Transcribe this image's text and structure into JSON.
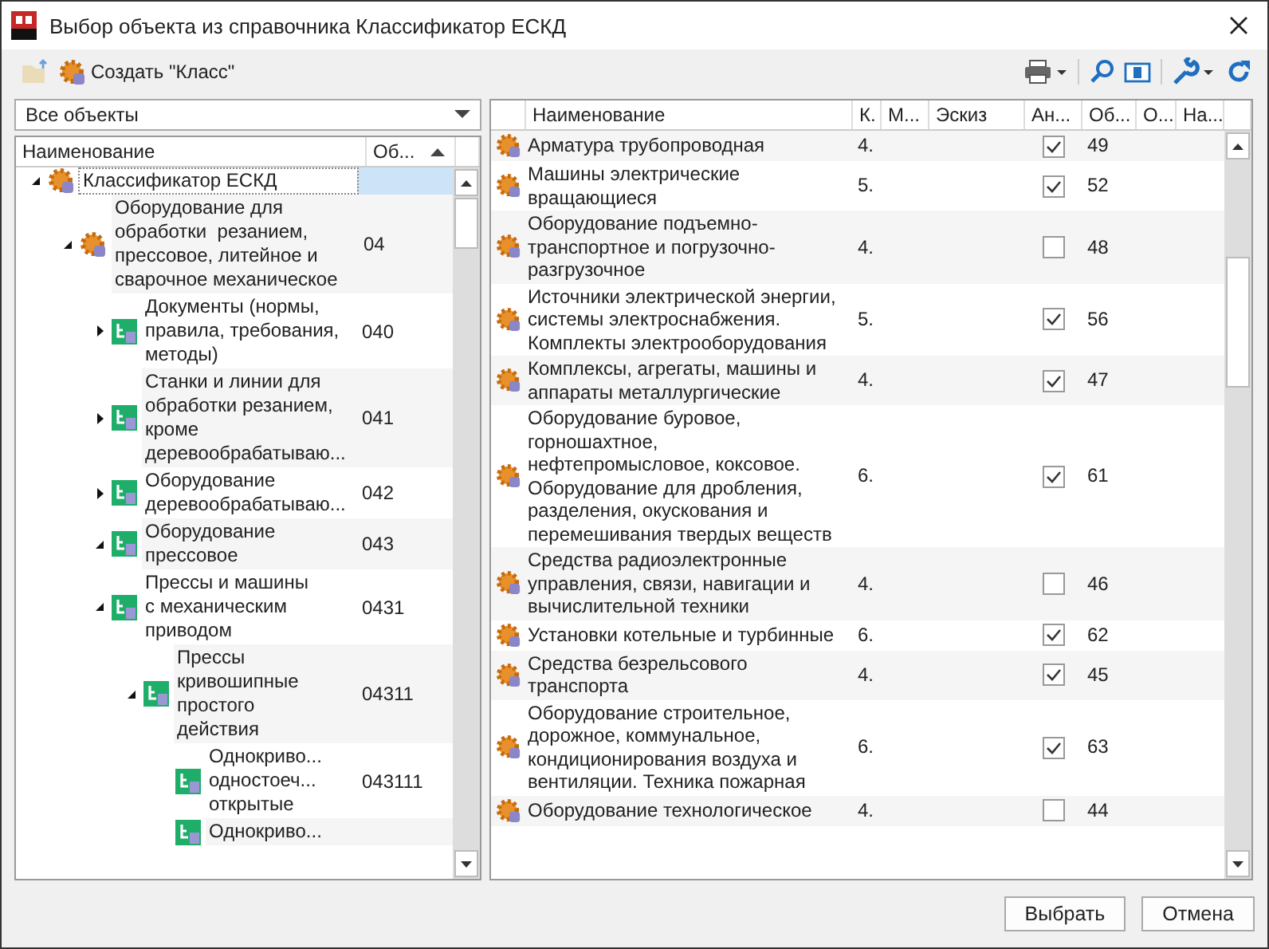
{
  "window": {
    "title": "Выбор объекта из справочника Классификатор ЕСКД"
  },
  "toolbar": {
    "create_button": "Создать \"Класс\""
  },
  "filter": {
    "value": "Все объекты"
  },
  "tree": {
    "columns": [
      "Наименование",
      "Об..."
    ],
    "items": [
      {
        "name": "Классификатор ЕСКД",
        "kind": "gear",
        "expanded": true,
        "selected": true,
        "children": [
          {
            "name": "Оборудование для\nобработки  резанием,\nпрессовое, литейное и\nсварочное механическое",
            "code": "04",
            "kind": "gear",
            "expanded": true,
            "selected": false,
            "children": [
              {
                "name": "Документы (нормы,\nправила, требования,\nметоды)",
                "code": "040",
                "kind": "class",
                "expanded": false,
                "selected": false
              },
              {
                "name": "Станки и линии для\nобработки резанием,\nкроме\nдеревообрабатываю...",
                "code": "041",
                "kind": "class",
                "expanded": false,
                "selected": false
              },
              {
                "name": "Оборудование\nдеревообрабатываю...",
                "code": "042",
                "kind": "class",
                "expanded": false,
                "selected": false
              },
              {
                "name": "Оборудование\nпрессовое",
                "code": "043",
                "kind": "class",
                "expanded": true,
                "selected": false,
                "children": [
                  {
                    "name": "Прессы и машины\nс механическим\nприводом",
                    "code": "0431",
                    "kind": "class",
                    "expanded": true,
                    "selected": false,
                    "children": [
                      {
                        "name": "Прессы\nкривошипные\nпростого\nдействия",
                        "code": "04311",
                        "kind": "class",
                        "expanded": true,
                        "selected": false,
                        "children": [
                          {
                            "name": "Однокриво...\nодностоеч...\nоткрытые",
                            "code": "043111",
                            "kind": "class",
                            "selected": false
                          },
                          {
                            "name": "Однокриво...",
                            "kind": "class",
                            "selected": false
                          }
                        ]
                      }
                    ]
                  }
                ]
              }
            ]
          }
        ]
      }
    ]
  },
  "table": {
    "columns": [
      "Наименование",
      "К.",
      "М...",
      "Эскиз",
      "Ан...",
      "Об...",
      "О...",
      "На..."
    ],
    "rows": [
      {
        "name": "Арматура трубопроводная",
        "k": "4.",
        "checked": true,
        "code": "49"
      },
      {
        "name": "Машины электрические\nвращающиеся",
        "k": "5.",
        "checked": true,
        "code": "52"
      },
      {
        "name": "Оборудование подъемно-\nтранспортное и погрузочно-\nразгрузочное",
        "k": "4.",
        "checked": false,
        "code": "48"
      },
      {
        "name": "Источники электрической энергии,\nсистемы электроснабжения.\nКомплекты электрооборудования",
        "k": "5.",
        "checked": true,
        "code": "56"
      },
      {
        "name": "Комплексы, агрегаты, машины и\nаппараты металлургические",
        "k": "4.",
        "checked": true,
        "code": "47"
      },
      {
        "name": "Оборудование буровое,\nгорношахтное,\nнефтепромысловое, коксовое.\nОборудование для дробления,\nразделения, окускования и\nперемешивания твердых веществ",
        "k": "6.",
        "checked": true,
        "code": "61"
      },
      {
        "name": "Средства радиоэлектронные\nуправления, связи, навигации и\nвычислительной техники",
        "k": "4.",
        "checked": false,
        "code": "46"
      },
      {
        "name": "Установки котельные и турбинные",
        "k": "6.",
        "checked": true,
        "code": "62"
      },
      {
        "name": "Средства безрельсового\nтранспорта",
        "k": "4.",
        "checked": true,
        "code": "45"
      },
      {
        "name": "Оборудование строительное,\nдорожное, коммунальное,\nкондиционирования воздуха и\nвентиляции. Техника пожарная",
        "k": "6.",
        "checked": true,
        "code": "63"
      },
      {
        "name": "Оборудование технологическое",
        "k": "4.",
        "checked": false,
        "code": "44"
      }
    ]
  },
  "buttons": [
    "Выбрать",
    "Отмена"
  ]
}
